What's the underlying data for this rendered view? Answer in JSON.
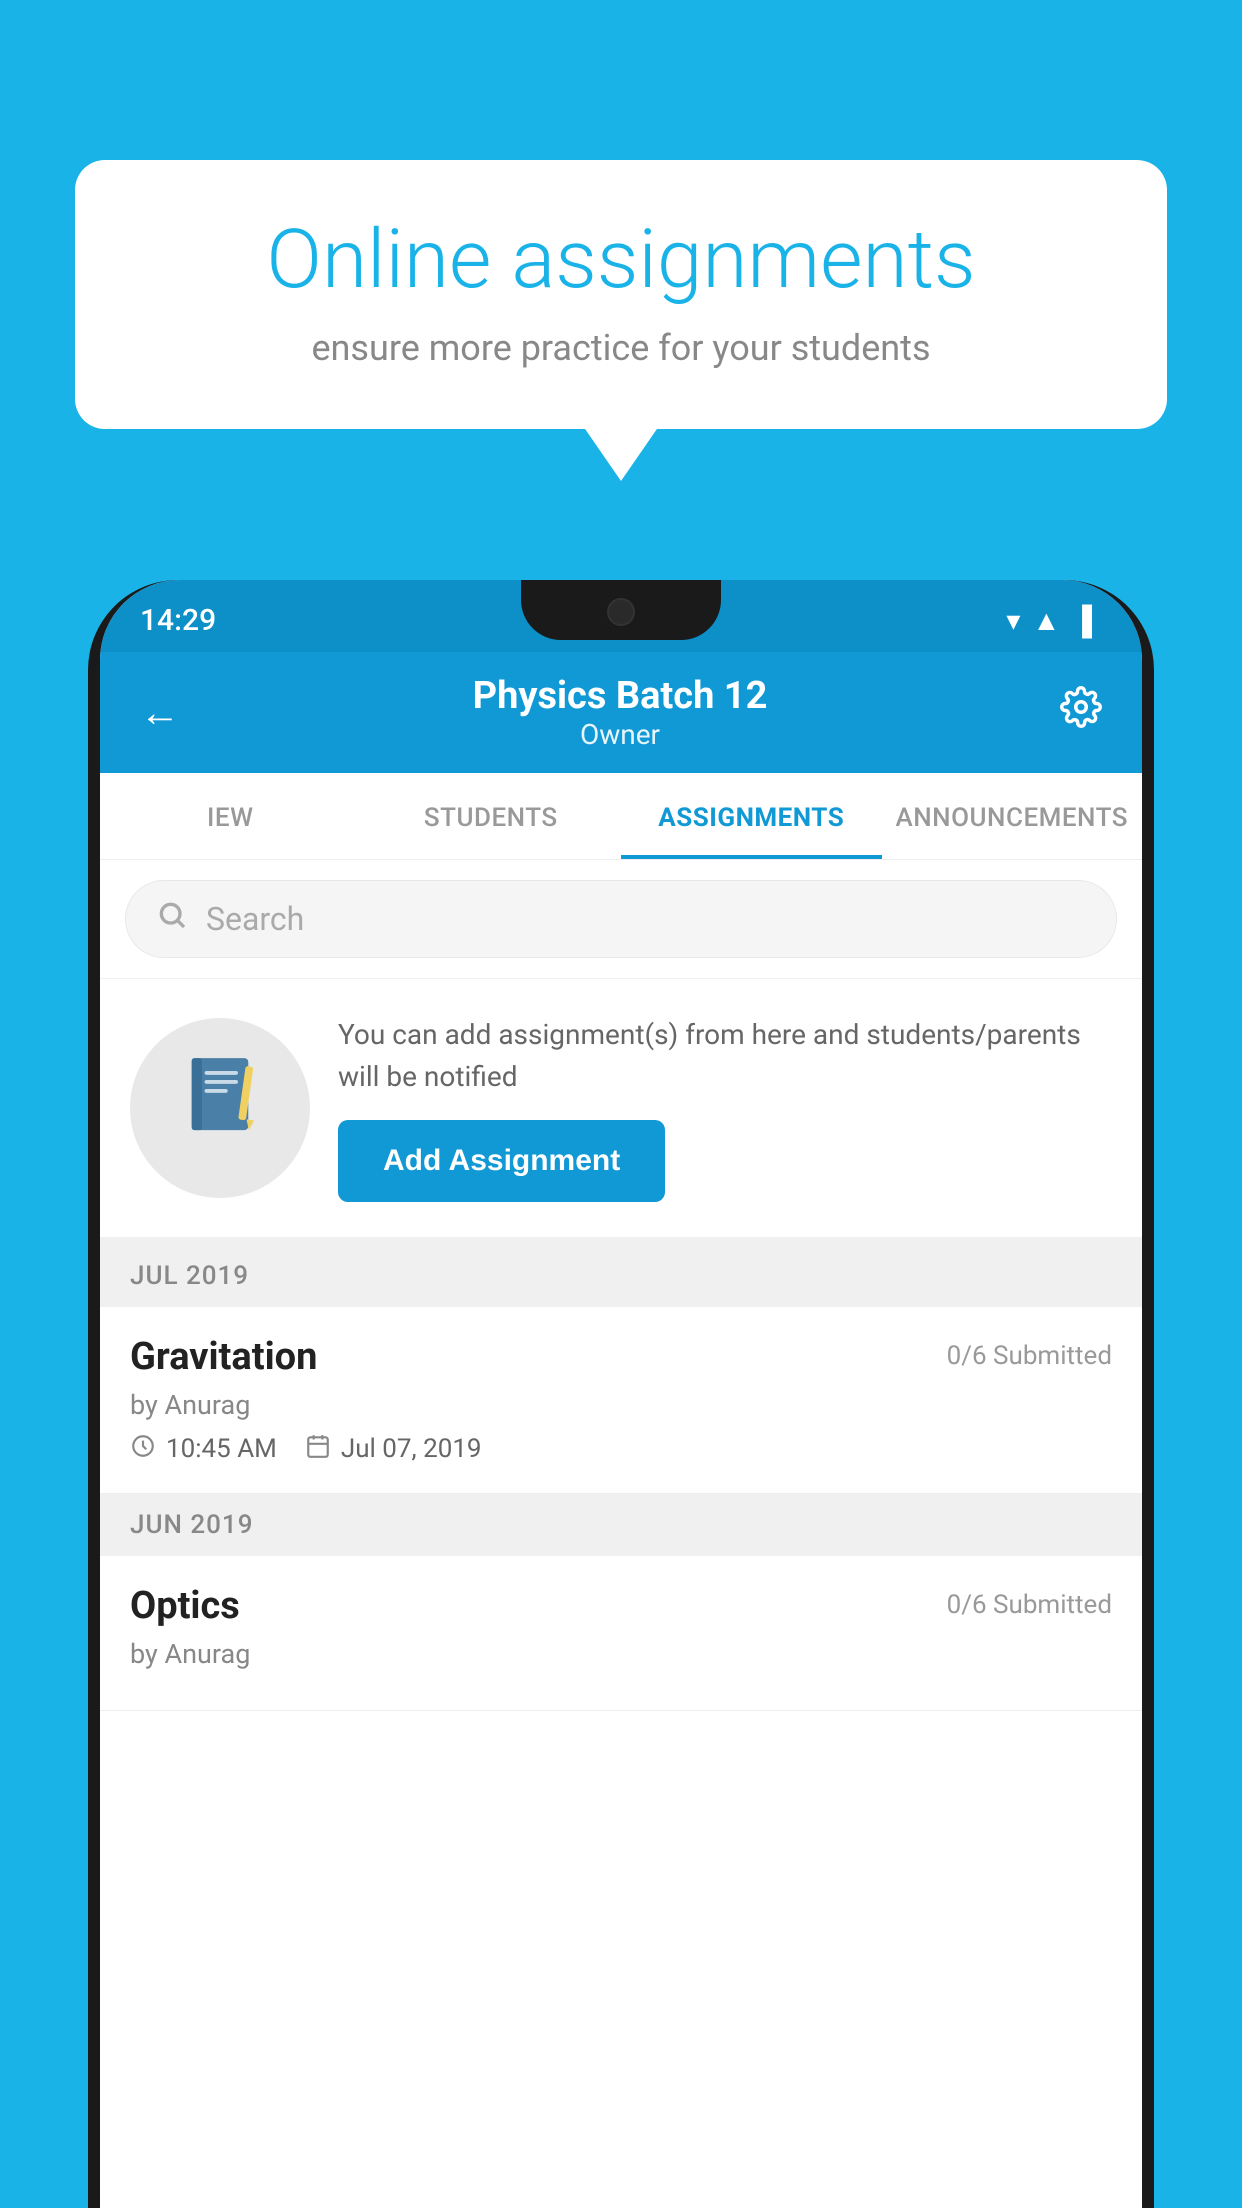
{
  "background_color": "#1ab3e8",
  "speech_bubble": {
    "title": "Online assignments",
    "subtitle": "ensure more practice for your students"
  },
  "status_bar": {
    "time": "14:29",
    "icons": [
      "wifi",
      "signal",
      "battery"
    ]
  },
  "header": {
    "title": "Physics Batch 12",
    "subtitle": "Owner",
    "back_label": "←",
    "settings_label": "⚙"
  },
  "tabs": [
    {
      "label": "IEW",
      "active": false
    },
    {
      "label": "STUDENTS",
      "active": false
    },
    {
      "label": "ASSIGNMENTS",
      "active": true
    },
    {
      "label": "ANNOUNCEMENTS",
      "active": false
    }
  ],
  "search": {
    "placeholder": "Search"
  },
  "promo": {
    "text": "You can add assignment(s) from here and students/parents will be notified",
    "button_label": "Add Assignment"
  },
  "months": [
    {
      "label": "JUL 2019",
      "assignments": [
        {
          "name": "Gravitation",
          "submitted": "0/6 Submitted",
          "by": "by Anurag",
          "time": "10:45 AM",
          "date": "Jul 07, 2019"
        }
      ]
    },
    {
      "label": "JUN 2019",
      "assignments": [
        {
          "name": "Optics",
          "submitted": "0/6 Submitted",
          "by": "by Anurag",
          "time": "",
          "date": ""
        }
      ]
    }
  ]
}
